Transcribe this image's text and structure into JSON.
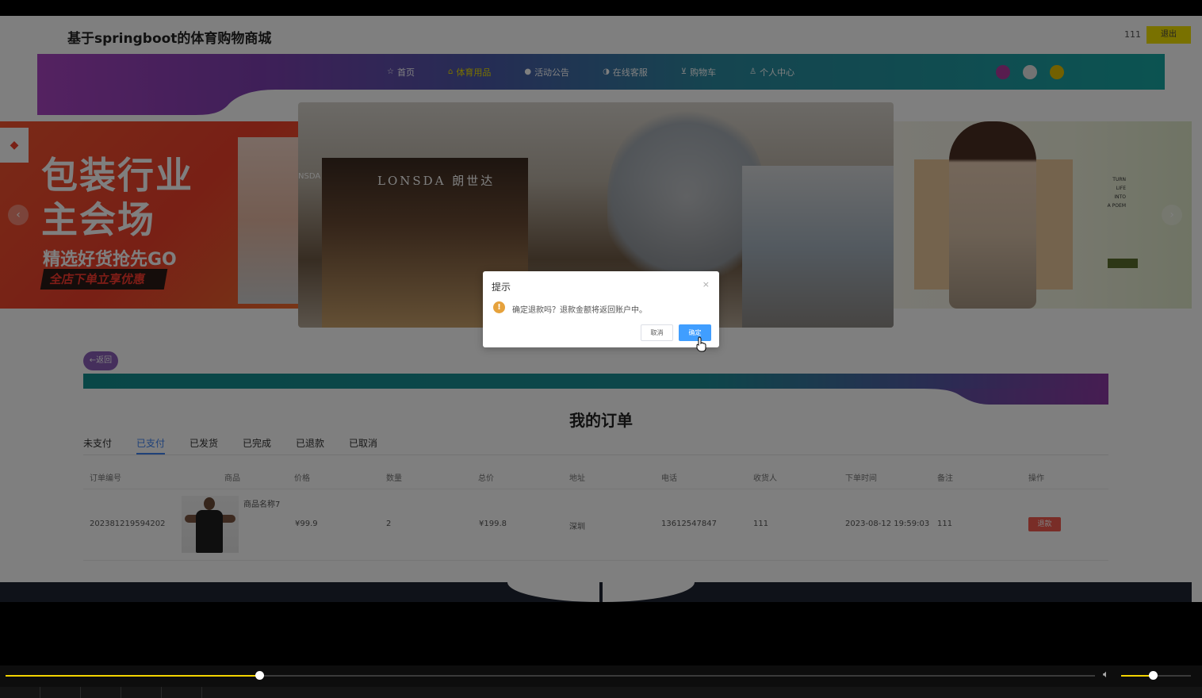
{
  "header": {
    "site_title": "基于springboot的体育购物商城",
    "username": "111",
    "logout_label": "退出"
  },
  "nav": {
    "items": [
      {
        "label": "首页",
        "icon": "star-icon"
      },
      {
        "label": "体育用品",
        "icon": "home-icon",
        "active": true
      },
      {
        "label": "活动公告",
        "icon": "circle-icon"
      },
      {
        "label": "在线客服",
        "icon": "headset-icon"
      },
      {
        "label": "购物车",
        "icon": "cart-icon"
      },
      {
        "label": "个人中心",
        "icon": "user-icon"
      }
    ],
    "theme_dots": [
      "#b03b9e",
      "#e6e6e6",
      "#e5c000"
    ],
    "accent": "#f3e300"
  },
  "carousel": {
    "left_slide": {
      "line1": "包装行业",
      "line2": "主会场",
      "subline": "精选好货抢先GO",
      "pill": "全店下单立享优惠"
    },
    "center_slide": {
      "store_sign": "LONSDA 朗世达",
      "store_sign_left": "NSDA"
    },
    "right_slide": {
      "poem_lines": [
        "TURN",
        "LIFE",
        "INTO",
        "A POEM"
      ]
    }
  },
  "back_label": "←返回",
  "orders_title": "我的订单",
  "tabs": [
    {
      "label": "未支付",
      "active": false
    },
    {
      "label": "已支付",
      "active": true
    },
    {
      "label": "已发货",
      "active": false
    },
    {
      "label": "已完成",
      "active": false
    },
    {
      "label": "已退款",
      "active": false
    },
    {
      "label": "已取消",
      "active": false
    }
  ],
  "table": {
    "headers": [
      "订单编号",
      "商品",
      "价格",
      "数量",
      "总价",
      "地址",
      "电话",
      "收货人",
      "下单时间",
      "备注",
      "操作"
    ],
    "rows": [
      {
        "order_no": "202381219594202",
        "product_name": "商品名称7",
        "price": "¥99.9",
        "quantity": "2",
        "total": "¥199.8",
        "address": "深圳",
        "phone": "13612547847",
        "receiver": "111",
        "order_time": "2023-08-12 19:59:03",
        "remark": "111",
        "action_label": "退款"
      }
    ]
  },
  "dialog": {
    "title": "提示",
    "close": "×",
    "message": "确定退款吗？退款金额将返回账户中。",
    "cancel_label": "取消",
    "confirm_label": "确定"
  },
  "player": {
    "progress_fraction": 0.233,
    "volume_fraction": 0.45,
    "accent": "#f3d400"
  }
}
